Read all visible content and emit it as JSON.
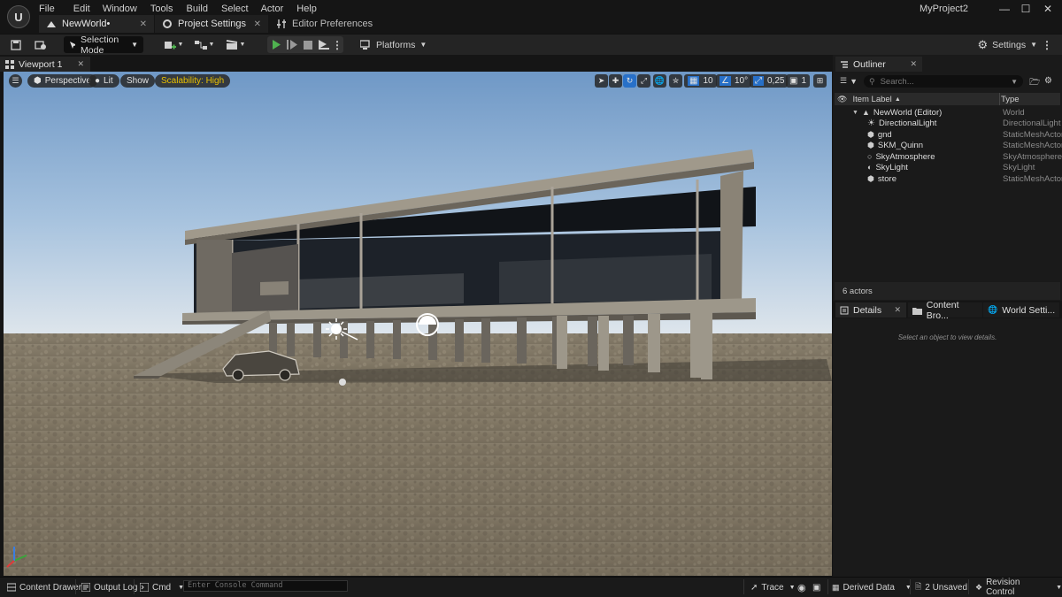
{
  "app": {
    "project_name": "MyProject2",
    "menu": [
      "File",
      "Edit",
      "Window",
      "Tools",
      "Build",
      "Select",
      "Actor",
      "Help"
    ]
  },
  "tabs": [
    {
      "label": "NewWorld•",
      "icon": "level-icon"
    },
    {
      "label": "Project Settings",
      "icon": "gears-icon"
    },
    {
      "label": "Editor Preferences",
      "icon": "sliders-icon"
    }
  ],
  "toolbar": {
    "selection_mode": "Selection Mode",
    "platforms": "Platforms",
    "settings": "Settings"
  },
  "viewport": {
    "tab_label": "Viewport 1",
    "perspective": "Perspective",
    "lit": "Lit",
    "show": "Show",
    "scalability": "Scalability: High",
    "grid_snap": "10",
    "rotation_snap": "10°",
    "scale_snap": "0,25",
    "camera_speed": "1"
  },
  "outliner": {
    "tab_label": "Outliner",
    "search_placeholder": "Search...",
    "col_label": "Item Label",
    "col_type": "Type",
    "items": [
      {
        "label": "NewWorld (Editor)",
        "type": "World",
        "icon": "world-icon"
      },
      {
        "label": "DirectionalLight",
        "type": "DirectionalLight",
        "icon": "sun-icon"
      },
      {
        "label": "gnd",
        "type": "StaticMeshActor",
        "icon": "mesh-icon"
      },
      {
        "label": "SKM_Quinn",
        "type": "StaticMeshActor",
        "icon": "mesh-icon"
      },
      {
        "label": "SkyAtmosphere",
        "type": "SkyAtmosphere",
        "icon": "atmosphere-icon"
      },
      {
        "label": "SkyLight",
        "type": "SkyLight",
        "icon": "skylight-icon"
      },
      {
        "label": "store",
        "type": "StaticMeshActor",
        "icon": "mesh-icon"
      }
    ],
    "actor_count": "6 actors"
  },
  "details": {
    "tabs": [
      "Details",
      "Content Bro...",
      "World Setti..."
    ],
    "hint": "Select an object to view details."
  },
  "bottombar": {
    "content_drawer": "Content Drawer",
    "output_log": "Output Log",
    "cmd": "Cmd",
    "console_placeholder": "Enter Console Command",
    "trace": "Trace",
    "derived_data": "Derived Data",
    "unsaved": "2 Unsaved",
    "revision_control": "Revision Control"
  },
  "colors": {
    "accent_play": "#4fb24f",
    "scalability_text": "#e8c000",
    "active_blue": "#2870c8"
  }
}
